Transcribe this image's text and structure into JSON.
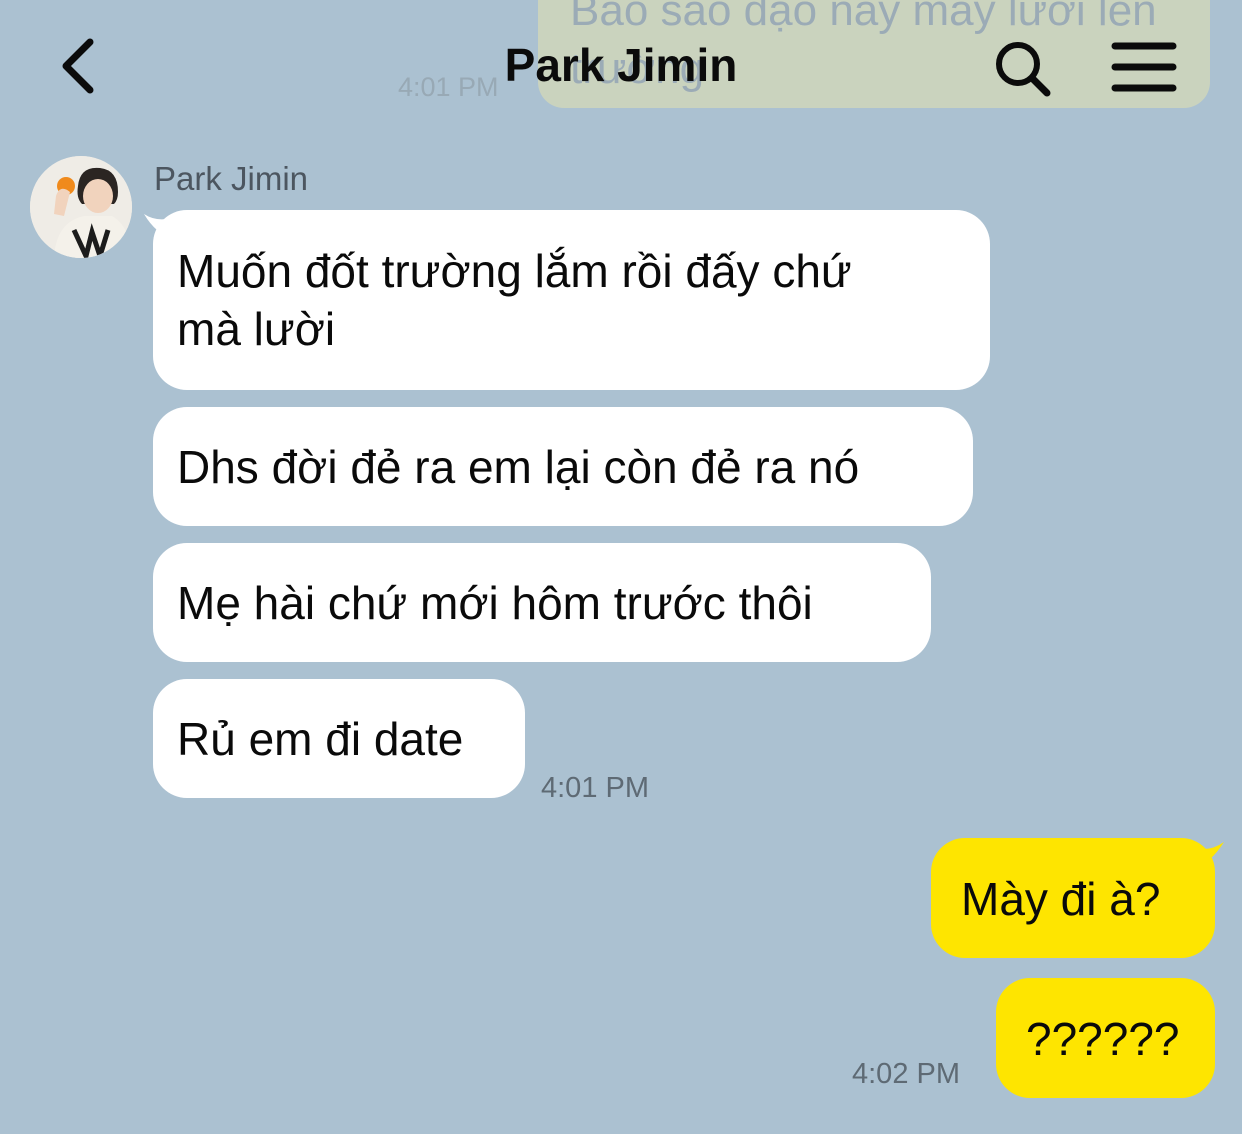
{
  "header": {
    "title": "Park Jimin",
    "back_icon": "chevron-left-icon",
    "search_icon": "search-icon",
    "menu_icon": "hamburger-menu-icon"
  },
  "faded_message": {
    "text": "Bao sao đạo này mày lười lên trường",
    "time": "4:01 PM"
  },
  "incoming": {
    "sender": "Park Jimin",
    "messages": [
      {
        "line1": "Muốn đốt trường lắm rồi đấy chứ",
        "line2": "mà lười"
      },
      {
        "text": "Dhs đời đẻ ra em lại còn đẻ ra nó"
      },
      {
        "text": "Mẹ hài chứ mới hôm trước thôi"
      },
      {
        "text": "Rủ em đi date"
      }
    ],
    "time": "4:01 PM"
  },
  "outgoing": {
    "messages": [
      {
        "text": "Mày đi à?"
      },
      {
        "text": "??????"
      }
    ],
    "time": "4:02 PM"
  },
  "colors": {
    "background": "#abc1d1",
    "incoming_bubble": "#ffffff",
    "outgoing_bubble": "#fee500"
  }
}
